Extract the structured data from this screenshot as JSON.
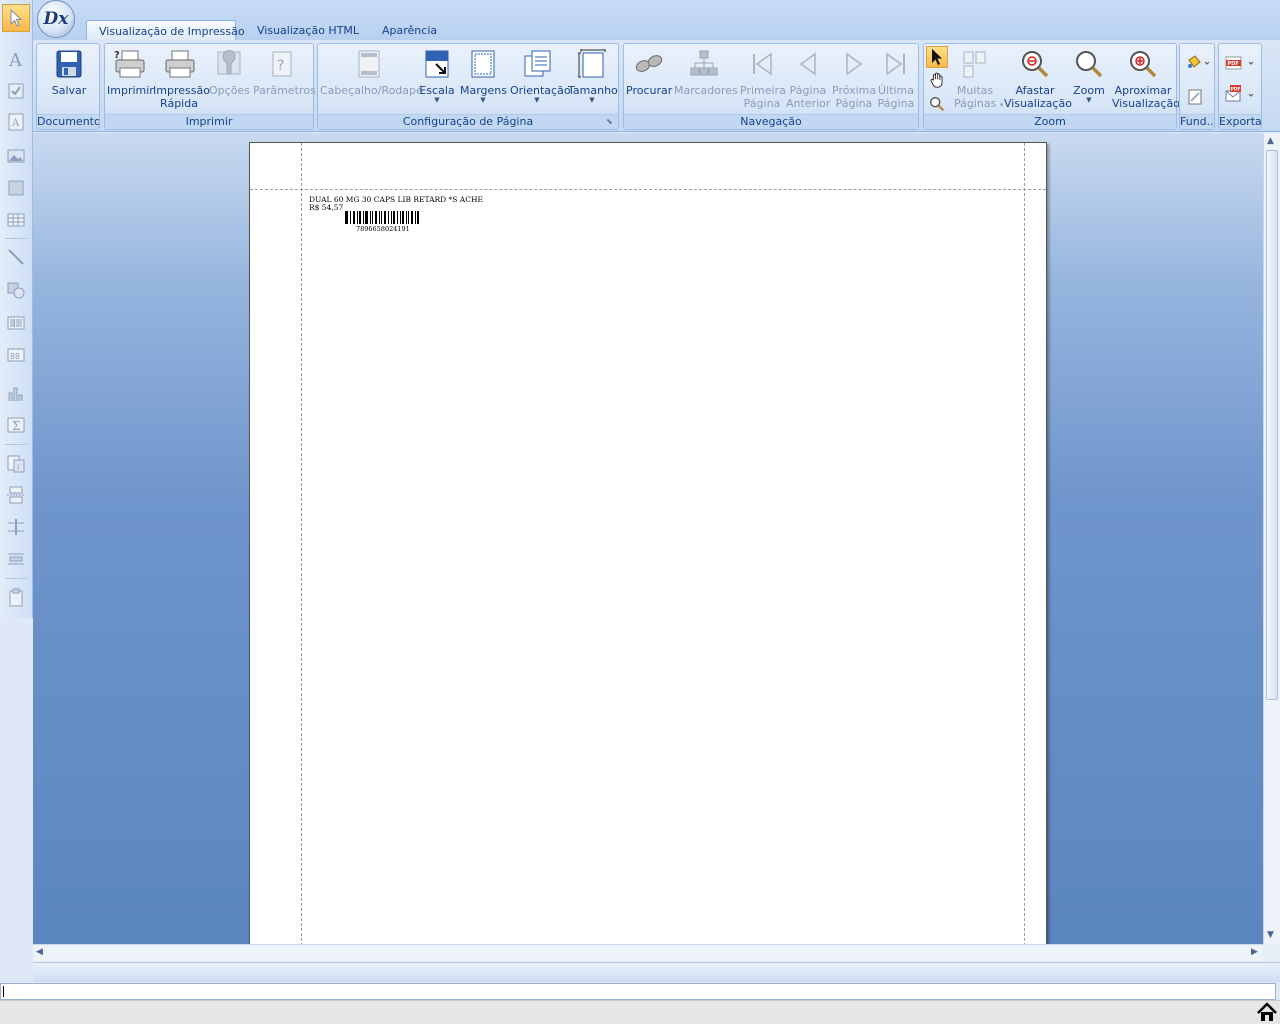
{
  "app": {
    "orb_text": "Dx"
  },
  "tabs": [
    {
      "label": "Visualização de Impressão"
    },
    {
      "label": "Visualização HTML"
    },
    {
      "label": "Aparência"
    }
  ],
  "ribbon": {
    "documento": {
      "label": "Documento",
      "salvar": "Salvar"
    },
    "imprimir": {
      "label": "Imprimir",
      "imprimir": "Imprimir",
      "impressao_rapida_1": "Impressão",
      "impressao_rapida_2": "Rápida",
      "opcoes": "Opções",
      "parametros": "Parâmetros"
    },
    "configuracao": {
      "label": "Configuração de Página",
      "cabecalho": "Cabeçalho/Rodapé",
      "escala": "Escala",
      "margens": "Margens",
      "orientacao": "Orientação",
      "tamanho": "Tamanho"
    },
    "navegacao": {
      "label": "Navegação",
      "procurar": "Procurar",
      "marcadores": "Marcadores",
      "primeira_1": "Primeira",
      "primeira_2": "Página",
      "anterior_1": "Página",
      "anterior_2": "Anterior",
      "proxima_1": "Próxima",
      "proxima_2": "Página",
      "ultima_1": "Última",
      "ultima_2": "Página"
    },
    "zoom": {
      "label": "Zoom",
      "muitas_1": "Muitas",
      "muitas_2": "Páginas",
      "afastar_1": "Afastar",
      "afastar_2": "Visualização",
      "zoom": "Zoom",
      "aproximar_1": "Aproximar",
      "aproximar_2": "Visualização"
    },
    "fundo": {
      "label": "Fund..."
    },
    "exportar": {
      "label": "Exportar"
    }
  },
  "document": {
    "product_line": "DUAL 60 MG 30 CAPS LIB RETARD *S ACHE",
    "price_line": "R$ 54,57",
    "barcode_number": "7896658024191"
  },
  "colors": {
    "accent": "#15428b",
    "active_tool": "#f9b84a",
    "workspace": "#5a86c0"
  }
}
